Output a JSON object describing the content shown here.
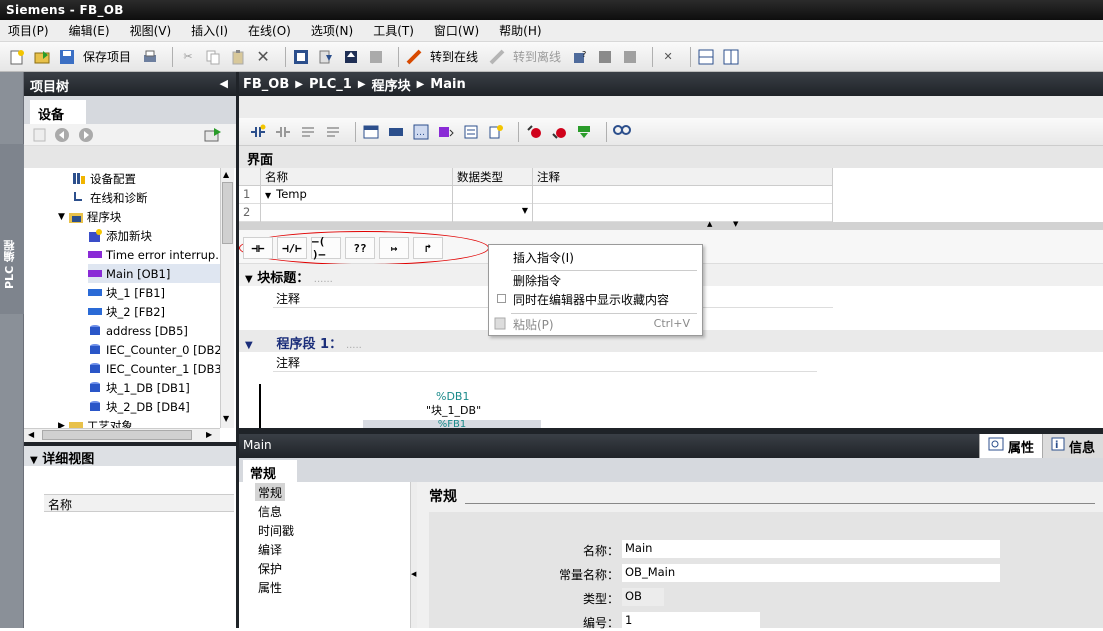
{
  "window": {
    "title": "Siemens  -  FB_OB"
  },
  "menu": [
    "项目(P)",
    "编辑(E)",
    "视图(V)",
    "插入(I)",
    "在线(O)",
    "选项(N)",
    "工具(T)",
    "窗口(W)",
    "帮助(H)"
  ],
  "toolbar": {
    "save_label": "保存项目",
    "go_online": "转到在线",
    "go_offline": "转到离线"
  },
  "project_tree": {
    "title": "项目树",
    "tab": "设备",
    "side_label": "PLC 编程",
    "items": [
      {
        "label": "设备配置",
        "icon": "device-config-icon"
      },
      {
        "label": "在线和诊断",
        "icon": "diagnostics-icon"
      },
      {
        "label": "程序块",
        "icon": "folder-icon"
      },
      {
        "label": "添加新块",
        "icon": "add-block-icon"
      },
      {
        "label": "Time error interrup...",
        "icon": "ob-block-icon"
      },
      {
        "label": "Main [OB1]",
        "icon": "ob-block-icon"
      },
      {
        "label": "块_1 [FB1]",
        "icon": "fb-block-icon"
      },
      {
        "label": "块_2 [FB2]",
        "icon": "fb-block-icon"
      },
      {
        "label": "address [DB5]",
        "icon": "db-block-icon"
      },
      {
        "label": "IEC_Counter_0 [DB2",
        "icon": "db-block-icon"
      },
      {
        "label": "IEC_Counter_1 [DB3",
        "icon": "db-block-icon"
      },
      {
        "label": "块_1_DB [DB1]",
        "icon": "db-block-icon"
      },
      {
        "label": "块_2_DB [DB4]",
        "icon": "db-block-icon"
      },
      {
        "label": "工艺对象",
        "icon": "folder-icon"
      }
    ]
  },
  "detail_view": {
    "title": "详细视图",
    "column": "名称"
  },
  "breadcrumb": {
    "items": [
      "FB_OB",
      "PLC_1",
      "程序块",
      "Main"
    ]
  },
  "interface": {
    "title": "界面",
    "columns": [
      "名称",
      "数据类型",
      "注释"
    ],
    "rows": [
      {
        "num": "1",
        "name": "Temp",
        "type": "",
        "comment": ""
      },
      {
        "num": "2",
        "name": "",
        "type": "",
        "comment": ""
      }
    ]
  },
  "ladder_toolbar": {
    "items": [
      "⊣⊢",
      "⊣/⊢",
      "–( )–",
      "??",
      "↦",
      "↱"
    ]
  },
  "block": {
    "title_label": "块标题：",
    "title_value": "......",
    "comment": "注释"
  },
  "network": {
    "title": "程序段 1：",
    "title_value": ".....",
    "comment": "注释",
    "db_addr": "%DB1",
    "db_name": "\"块_1_DB\"",
    "fb_addr": "%FB1"
  },
  "context_menu": {
    "items": [
      {
        "label": "插入指令(I)",
        "enabled": true
      },
      {
        "label": "删除指令",
        "enabled": true
      },
      {
        "label": "同时在编辑器中显示收藏内容",
        "enabled": true,
        "checkbox": true
      },
      {
        "label": "粘贴(P)",
        "enabled": false,
        "shortcut": "Ctrl+V"
      }
    ]
  },
  "properties": {
    "header_title": "Main",
    "tabs": [
      "属性",
      "信息"
    ],
    "general_tab": "常规",
    "nav": [
      "常规",
      "信息",
      "时间戳",
      "编译",
      "保护",
      "属性"
    ],
    "section_title": "常规",
    "fields": [
      {
        "label": "名称：",
        "value": "Main"
      },
      {
        "label": "常量名称：",
        "value": "OB_Main"
      },
      {
        "label": "类型：",
        "value": "OB"
      },
      {
        "label": "编号：",
        "value": "1"
      }
    ]
  },
  "colors": {
    "dark_header": "#1f2328",
    "network_title": "#1b2e7a",
    "highlight_ellipse": "#e00000",
    "db_cyan": "#1a8a8a"
  }
}
